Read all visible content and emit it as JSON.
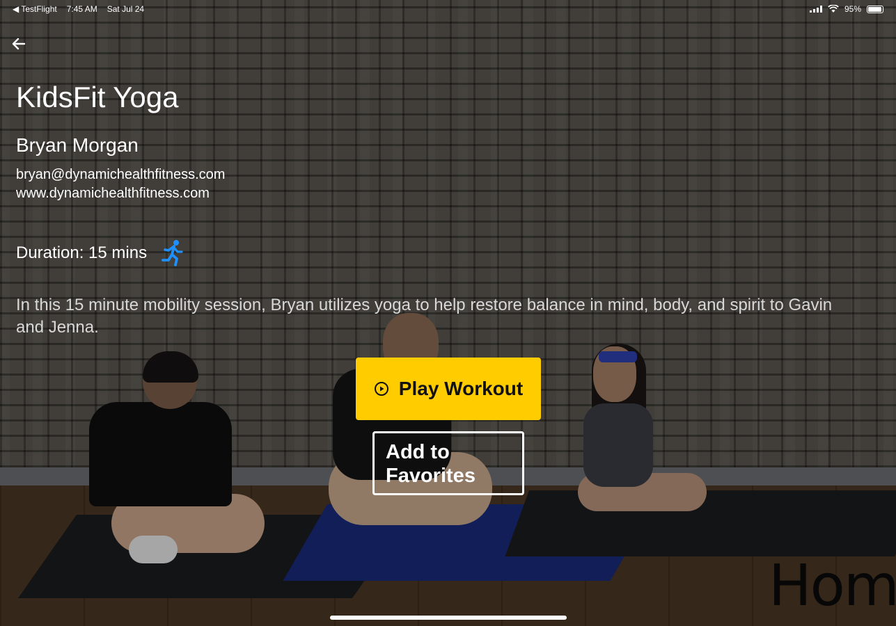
{
  "status_bar": {
    "carrier": "◀ TestFlight",
    "time": "7:45 AM",
    "date": "Sat Jul 24",
    "battery": "95%"
  },
  "workout": {
    "title": "KidsFit Yoga",
    "trainer": "Bryan Morgan",
    "email": "bryan@dynamichealthfitness.com",
    "website": "www.dynamichealthfitness.com",
    "duration": "Duration: 15 mins",
    "description": "In this 15 minute mobility session, Bryan utilizes yoga to help restore balance in mind, body, and spirit to Gavin and Jenna."
  },
  "actions": {
    "play_label": "Play Workout",
    "favorites_label": "Add to Favorites"
  },
  "background": {
    "wordmark": "Home"
  },
  "colors": {
    "accent": "#ffcc00",
    "run_icon": "#1e90ff",
    "text": "#ffffff"
  },
  "icons": {
    "back": "arrow-left-icon",
    "duration": "running-person-icon",
    "play": "play-circle-icon"
  }
}
